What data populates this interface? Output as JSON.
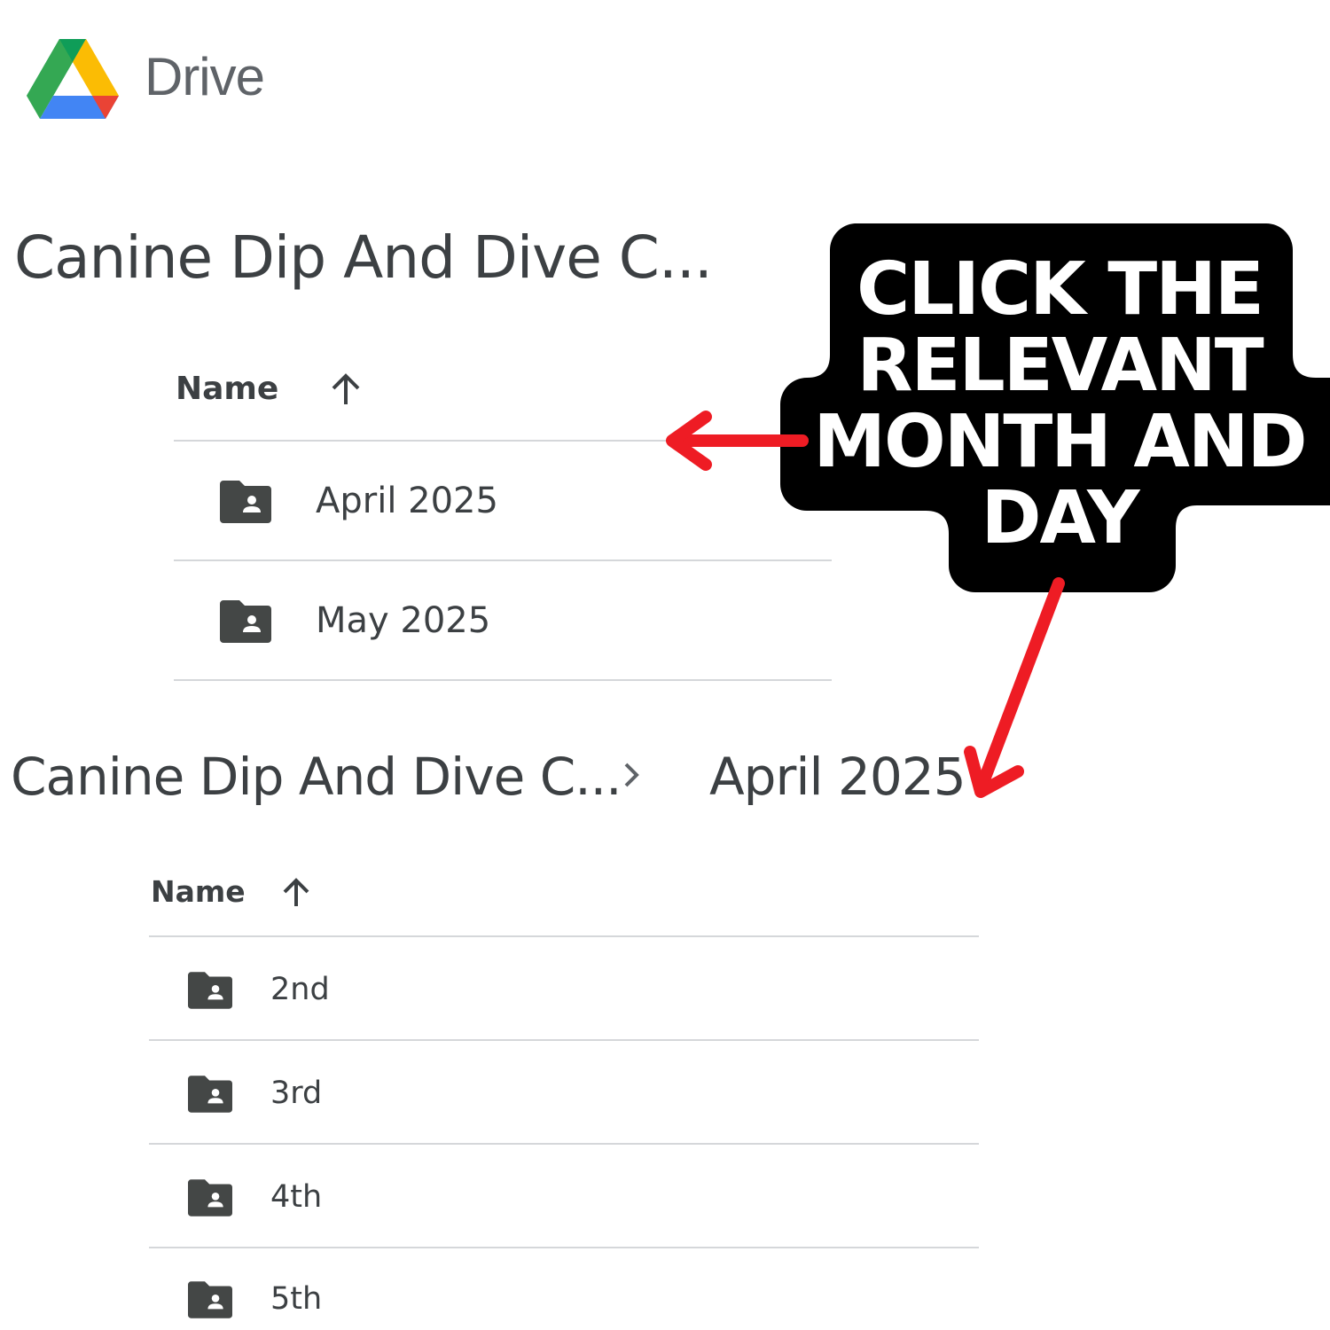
{
  "app": {
    "title": "Drive",
    "logo_icon": "google-drive-logo-icon"
  },
  "view1": {
    "folder_title": "Canine Dip And Dive C...",
    "column_header": "Name",
    "sort_icon": "arrow-up-icon",
    "rows": [
      {
        "label": "April 2025",
        "icon": "shared-folder-icon"
      },
      {
        "label": "May 2025",
        "icon": "shared-folder-icon"
      }
    ]
  },
  "view2": {
    "breadcrumb": {
      "root": "Canine Dip And Dive C...",
      "separator_icon": "chevron-right-icon",
      "current": "April 2025"
    },
    "column_header": "Name",
    "sort_icon": "arrow-up-icon",
    "rows": [
      {
        "label": "2nd",
        "icon": "shared-folder-icon"
      },
      {
        "label": "3rd",
        "icon": "shared-folder-icon"
      },
      {
        "label": "4th",
        "icon": "shared-folder-icon"
      },
      {
        "label": "5th",
        "icon": "shared-folder-icon"
      }
    ]
  },
  "callout": {
    "lines": [
      "CLICK THE",
      "RELEVANT",
      "MONTH AND",
      "DAY"
    ],
    "background_color": "#000000",
    "text_color": "#ffffff",
    "arrow_color": "#ee1c24"
  }
}
